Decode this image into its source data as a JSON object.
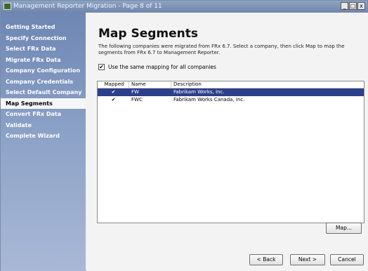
{
  "window": {
    "title": "Management Reporter Migration - Page 8 of 11",
    "min": "_",
    "max": "□",
    "close": "x"
  },
  "sidebar": {
    "items": [
      {
        "label": "Getting Started",
        "active": false
      },
      {
        "label": "Specify Connection",
        "active": false
      },
      {
        "label": "Select FRx Data",
        "active": false
      },
      {
        "label": "Migrate FRx Data",
        "active": false
      },
      {
        "label": "Company Configuration",
        "active": false
      },
      {
        "label": "Company Credentials",
        "active": false
      },
      {
        "label": "Select Default Company",
        "active": false
      },
      {
        "label": "Map Segments",
        "active": true
      },
      {
        "label": "Convert FRx Data",
        "active": false
      },
      {
        "label": "Validate",
        "active": false
      },
      {
        "label": "Complete Wizard",
        "active": false
      }
    ]
  },
  "main": {
    "title": "Map Segments",
    "description": "The following companies were migrated from FRx 6.7. Select a company, then click Map to map the segments from FRx 6.7 to Management Reporter.",
    "same_mapping_label": "Use the same mapping for all companies",
    "same_mapping_checked": "✔"
  },
  "grid": {
    "columns": [
      "Mapped",
      "Name",
      "Description"
    ],
    "rows": [
      {
        "mapped": "✔",
        "name": "FW",
        "description": "Fabrikam Works, Inc.",
        "selected": true
      },
      {
        "mapped": "✔",
        "name": "FWC",
        "description": "Fabrikam Works Canada, Inc.",
        "selected": false
      }
    ]
  },
  "buttons": {
    "map": "Map...",
    "back": "< Back",
    "next": "Next >",
    "cancel": "Cancel"
  }
}
